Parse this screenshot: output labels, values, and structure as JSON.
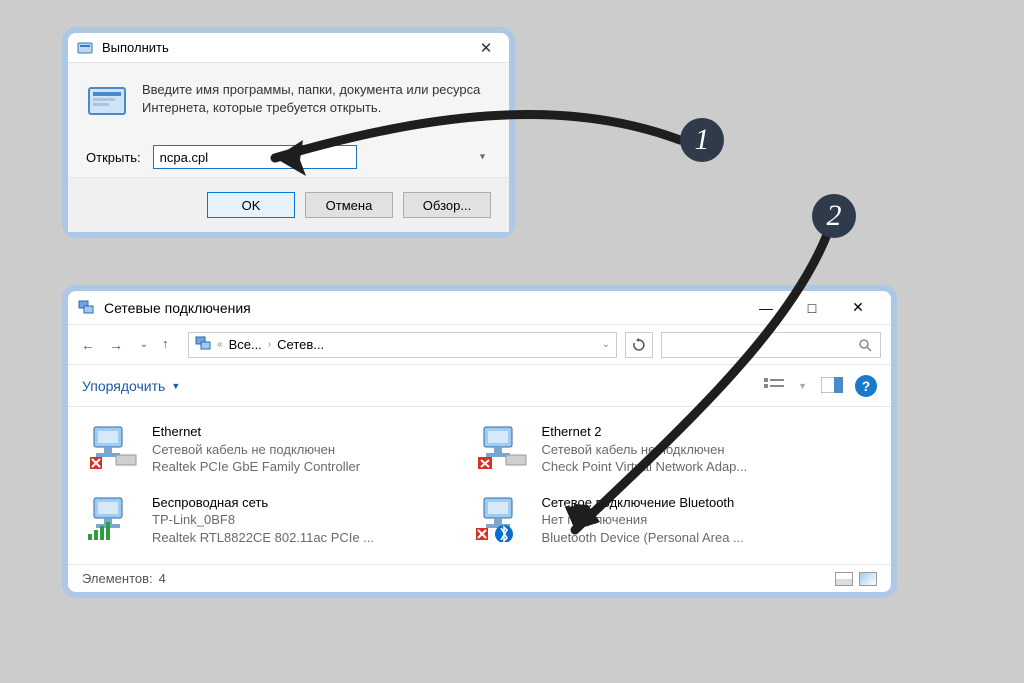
{
  "run_dialog": {
    "title": "Выполнить",
    "instruction": "Введите имя программы, папки, документа или ресурса Интернета, которые требуется открыть.",
    "open_label": "Открыть:",
    "input_value": "ncpa.cpl",
    "buttons": {
      "ok": "OK",
      "cancel": "Отмена",
      "browse": "Обзор..."
    }
  },
  "explorer": {
    "title": "Сетевые подключения",
    "breadcrumb": {
      "part1": "Все...",
      "part2": "Сетев..."
    },
    "organize_label": "Упорядочить",
    "connections": [
      {
        "name": "Ethernet",
        "status": "Сетевой кабель не подключен",
        "device": "Realtek PCIe GbE Family Controller",
        "badge": "error"
      },
      {
        "name": "Ethernet 2",
        "status": "Сетевой кабель не подключен",
        "device": "Check Point Virtual Network Adap...",
        "badge": "error"
      },
      {
        "name": "Беспроводная сеть",
        "status": "TP-Link_0BF8",
        "device": "Realtek RTL8822CE 802.11ac PCIe ...",
        "badge": "wifi"
      },
      {
        "name": "Сетевое подключение Bluetooth",
        "status": "Нет подключения",
        "device": "Bluetooth Device (Personal Area ...",
        "badge": "bluetooth-error"
      }
    ],
    "status_bar": {
      "label": "Элементов:",
      "count": "4"
    }
  },
  "annotations": {
    "one": "1",
    "two": "2"
  }
}
